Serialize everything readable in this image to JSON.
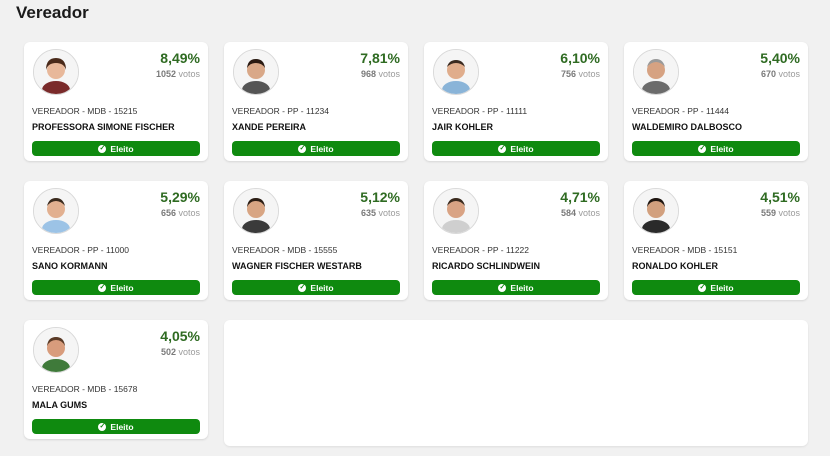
{
  "page": {
    "title": "Vereador"
  },
  "candidates": [
    {
      "pct": "8,49%",
      "votes": "1052",
      "votes_label": "votos",
      "party_line": "VEREADOR - MDB - 15215",
      "name": "PROFESSORA SIMONE FISCHER",
      "status": "Eleito"
    },
    {
      "pct": "7,81%",
      "votes": "968",
      "votes_label": "votos",
      "party_line": "VEREADOR - PP - 11234",
      "name": "XANDE PEREIRA",
      "status": "Eleito"
    },
    {
      "pct": "6,10%",
      "votes": "756",
      "votes_label": "votos",
      "party_line": "VEREADOR - PP - 11111",
      "name": "JAIR KOHLER",
      "status": "Eleito"
    },
    {
      "pct": "5,40%",
      "votes": "670",
      "votes_label": "votos",
      "party_line": "VEREADOR - PP - 11444",
      "name": "WALDEMIRO DALBOSCO",
      "status": "Eleito"
    },
    {
      "pct": "5,29%",
      "votes": "656",
      "votes_label": "votos",
      "party_line": "VEREADOR - PP - 11000",
      "name": "SANO KORMANN",
      "status": "Eleito"
    },
    {
      "pct": "5,12%",
      "votes": "635",
      "votes_label": "votos",
      "party_line": "VEREADOR - MDB - 15555",
      "name": "WAGNER FISCHER WESTARB",
      "status": "Eleito"
    },
    {
      "pct": "4,71%",
      "votes": "584",
      "votes_label": "votos",
      "party_line": "VEREADOR - PP - 11222",
      "name": "RICARDO SCHLINDWEIN",
      "status": "Eleito"
    },
    {
      "pct": "4,51%",
      "votes": "559",
      "votes_label": "votos",
      "party_line": "VEREADOR - MDB - 15151",
      "name": "RONALDO KOHLER",
      "status": "Eleito"
    },
    {
      "pct": "4,05%",
      "votes": "502",
      "votes_label": "votos",
      "party_line": "VEREADOR - MDB - 15678",
      "name": "MALA GUMS",
      "status": "Eleito"
    }
  ],
  "icons": {
    "photo": "avatar-photo",
    "status": "check-circle-icon"
  },
  "colors": {
    "accent": "#0f8a0f",
    "percentage": "#2f6b22"
  }
}
